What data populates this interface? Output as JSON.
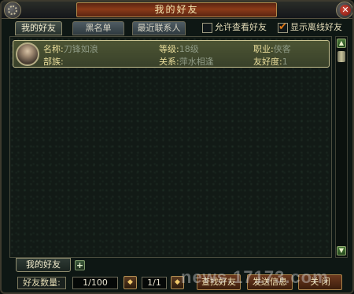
{
  "window": {
    "title": "我的好友"
  },
  "tabs": [
    {
      "label": "我的好友",
      "active": true
    },
    {
      "label": "黑名单",
      "active": false
    },
    {
      "label": "最近联系人",
      "active": false
    }
  ],
  "options": {
    "allow_view_label": "允许查看好友",
    "allow_view_checked": false,
    "show_offline_label": "显示离线好友",
    "show_offline_checked": true
  },
  "friends": [
    {
      "name_key": "名称:",
      "name_val": "刀锋如浪",
      "level_key": "等级:",
      "level_val": "18级",
      "job_key": "职业:",
      "job_val": "侠客",
      "tribe_key": "部族:",
      "tribe_val": "",
      "relation_key": "关系:",
      "relation_val": "萍水相逢",
      "friendship_key": "友好度:",
      "friendship_val": "1"
    }
  ],
  "group_tab": {
    "label": "我的好友",
    "add_symbol": "+"
  },
  "footer": {
    "count_label": "好友数量:",
    "count_value": "1/100",
    "page_value": "1/1",
    "prev_symbol": "◆",
    "next_symbol": "◆",
    "find_button": "查找好友",
    "send_button": "发送信息",
    "close_button": "关 闭"
  },
  "watermark": "news.17173.com",
  "colors": {
    "accent": "#e07a18",
    "row_highlight": "#4c5433",
    "key_text": "#ecdf9c",
    "value_text": "#8f9b86"
  }
}
